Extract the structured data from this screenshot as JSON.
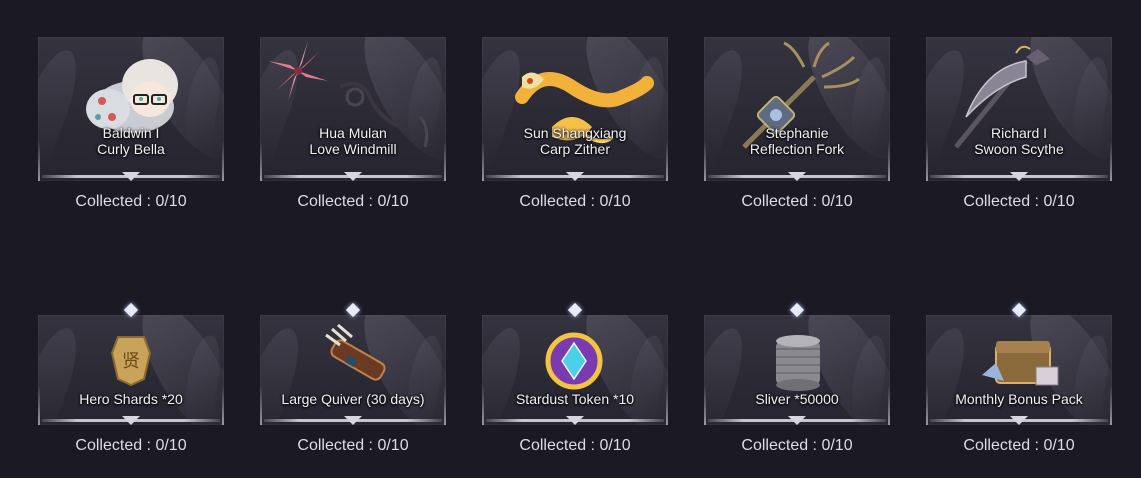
{
  "rewards_top": [
    {
      "hero": "Baldwin I",
      "item": "Curly Bella",
      "collected": "Collected : 0/10"
    },
    {
      "hero": "Hua Mulan",
      "item": "Love Windmill",
      "collected": "Collected : 0/10"
    },
    {
      "hero": "Sun Shangxiang",
      "item": "Carp Zither",
      "collected": "Collected : 0/10"
    },
    {
      "hero": "Stephanie",
      "item": "Reflection Fork",
      "collected": "Collected : 0/10"
    },
    {
      "hero": "Richard I",
      "item": "Swoon Scythe",
      "collected": "Collected : 0/10"
    }
  ],
  "rewards_bottom": [
    {
      "item": "Hero Shards *20",
      "collected": "Collected : 0/10",
      "icon": "hero-shard-icon"
    },
    {
      "item": "Large Quiver (30 days)",
      "collected": "Collected : 0/10",
      "icon": "quiver-icon"
    },
    {
      "item": "Stardust Token *10",
      "collected": "Collected : 0/10",
      "icon": "stardust-token-icon"
    },
    {
      "item": "Sliver *50000",
      "collected": "Collected : 0/10",
      "icon": "sliver-coins-icon"
    },
    {
      "item": "Monthly Bonus Pack",
      "collected": "Collected : 0/10",
      "icon": "bonus-pack-icon"
    }
  ],
  "colors": {
    "background": "#1b1a24",
    "card": "#2e2d38",
    "accent": "#e8ecf8"
  }
}
